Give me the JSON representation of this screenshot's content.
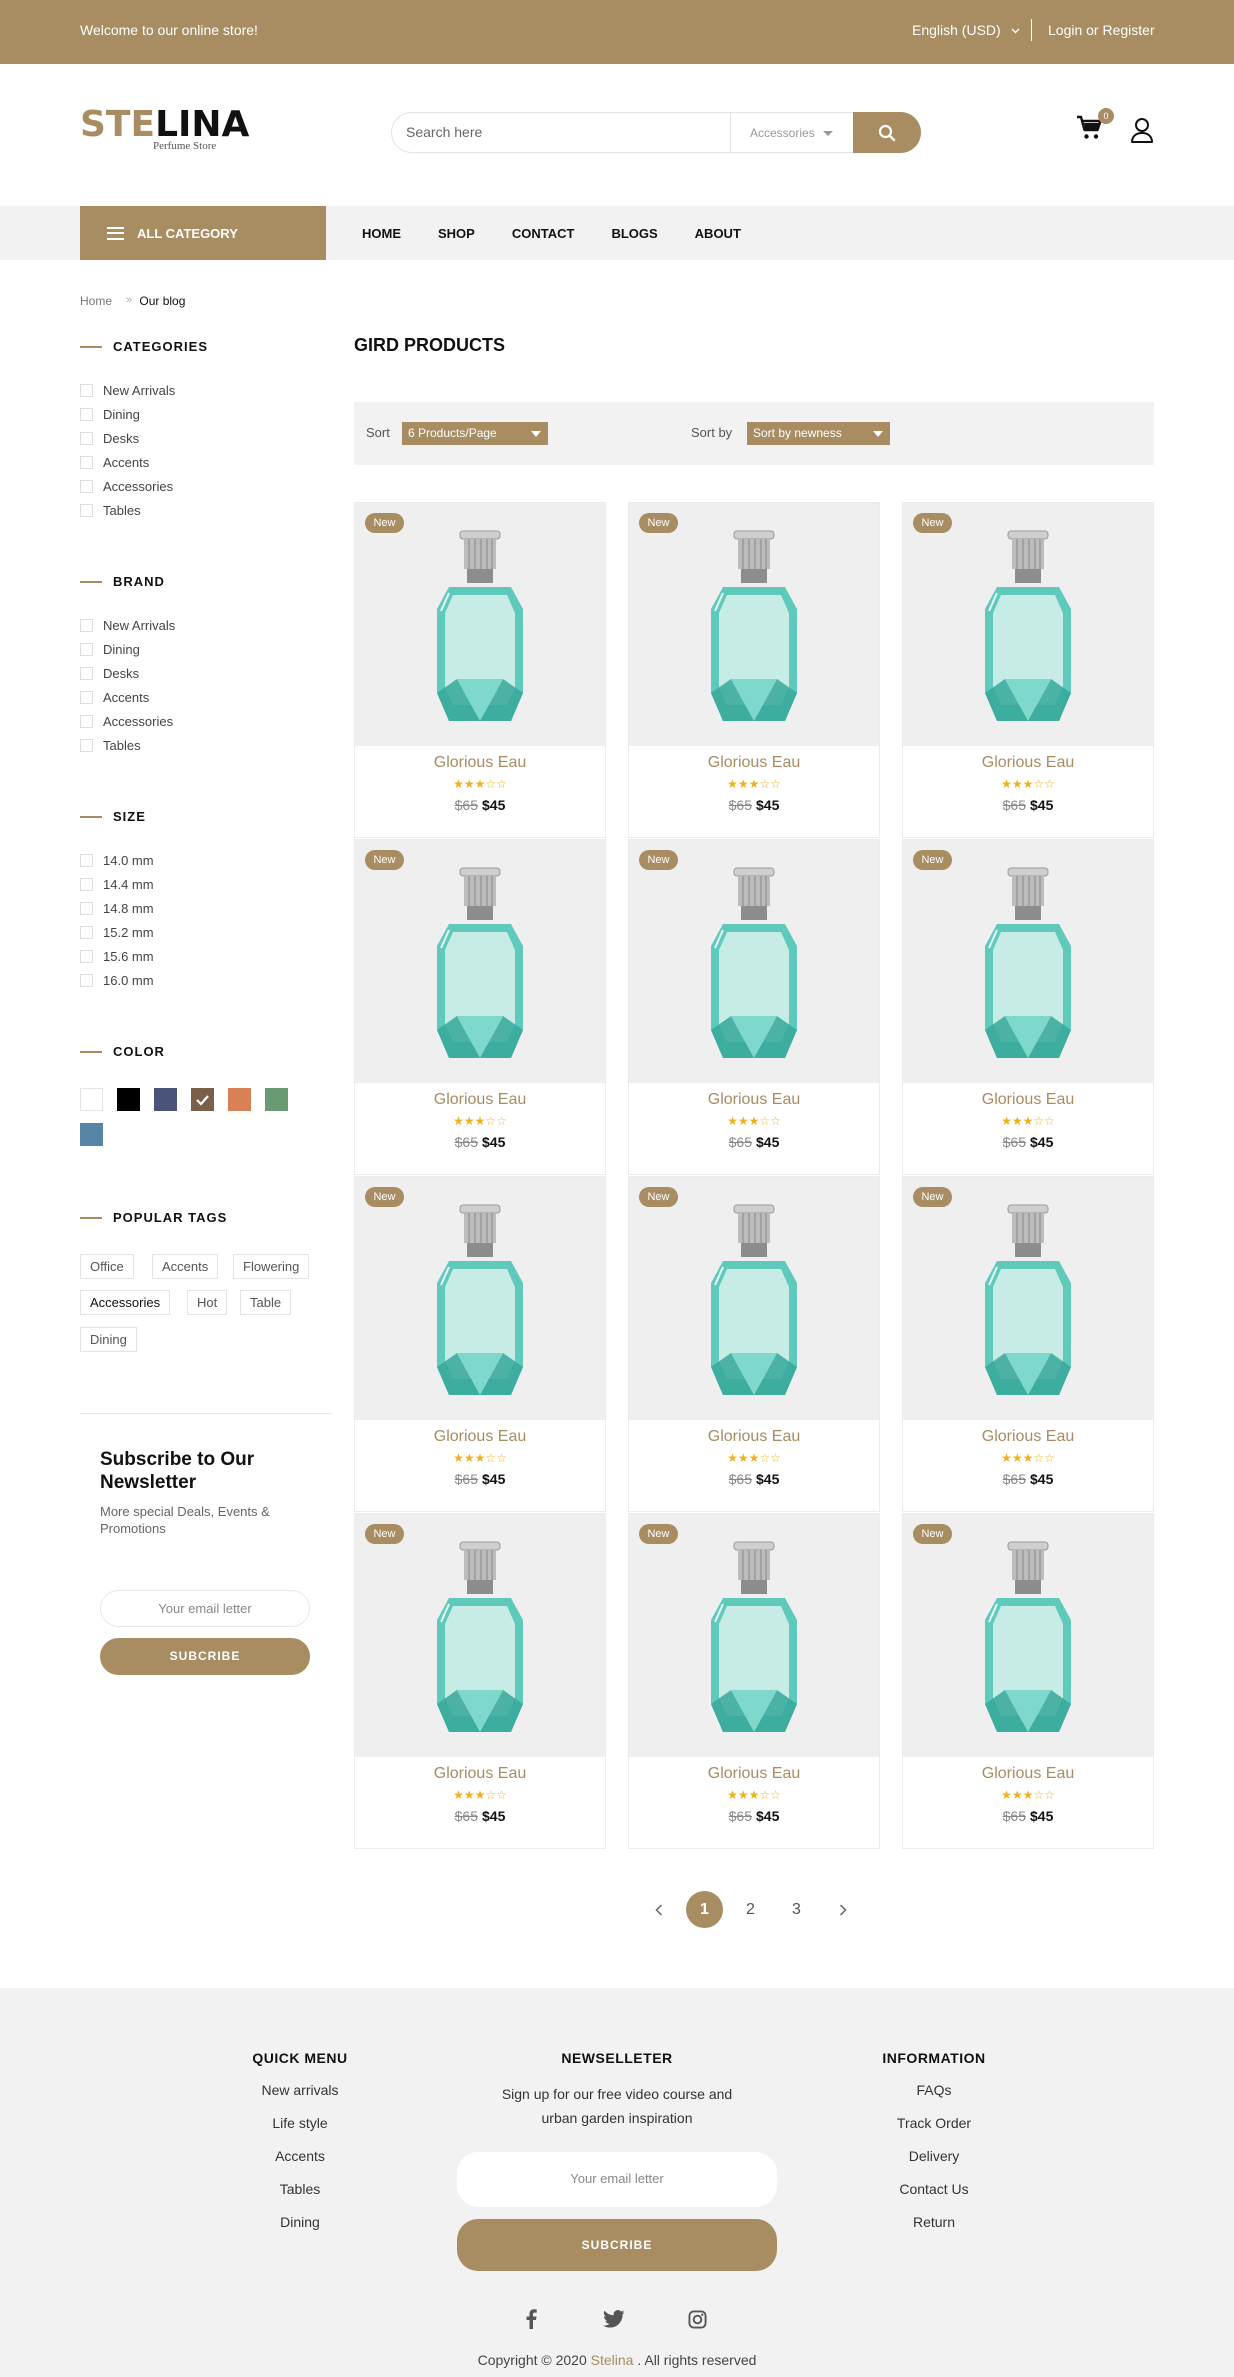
{
  "topbar": {
    "welcome": "Welcome to our online store!",
    "language": "English (USD)",
    "login": "Login or Register"
  },
  "logo": {
    "part1": "STE",
    "part2": "LINA",
    "tagline": "Perfume Store"
  },
  "search": {
    "placeholder": "Search here",
    "category": "Accessories"
  },
  "cart": {
    "count": "0"
  },
  "nav": {
    "all_category": "ALL CATEGORY",
    "items": [
      "HOME",
      "SHOP",
      "CONTACT",
      "BLOGS",
      "ABOUT"
    ]
  },
  "breadcrumb": {
    "home": "Home",
    "current": "Our blog"
  },
  "sidebar": {
    "categories": {
      "title": "CATEGORIES",
      "items": [
        "New Arrivals",
        "Dining",
        "Desks",
        "Accents",
        "Accessories",
        "Tables"
      ]
    },
    "brand": {
      "title": "BRAND",
      "items": [
        "New Arrivals",
        "Dining",
        "Desks",
        "Accents",
        "Accessories",
        "Tables"
      ]
    },
    "size": {
      "title": "SIZE",
      "items": [
        "14.0 mm",
        "14.4 mm",
        "14.8 mm",
        "15.2 mm",
        "15.6 mm",
        "16.0 mm"
      ]
    },
    "color": {
      "title": "COLOR",
      "swatches": [
        "#ffffff",
        "#000000",
        "#4a5478",
        "#7a5f4a",
        "#d98055",
        "#6a9a72",
        "#5885a5"
      ],
      "selected_index": 3
    },
    "tags": {
      "title": "POPULAR TAGS",
      "items": [
        "Office",
        "Accents",
        "Flowering",
        "Accessories",
        "Hot",
        "Table",
        "Dining"
      ]
    },
    "subscribe": {
      "title": "Subscribe to Our Newsletter",
      "text": "More special Deals, Events & Promotions",
      "placeholder": "Your email letter",
      "button": "SUBCRIBE"
    }
  },
  "main": {
    "title": "GIRD PRODUCTS",
    "sort_label": "Sort",
    "sort_value": "6 Products/Page",
    "sortby_label": "Sort by",
    "sortby_value": "Sort by newness",
    "products": [
      {
        "badge": "New",
        "name": "Glorious Eau",
        "rating": 3,
        "old_price": "$65",
        "price": "$45"
      },
      {
        "badge": "New",
        "name": "Glorious Eau",
        "rating": 3,
        "old_price": "$65",
        "price": "$45"
      },
      {
        "badge": "New",
        "name": "Glorious Eau",
        "rating": 3,
        "old_price": "$65",
        "price": "$45"
      },
      {
        "badge": "New",
        "name": "Glorious Eau",
        "rating": 3,
        "old_price": "$65",
        "price": "$45"
      },
      {
        "badge": "New",
        "name": "Glorious Eau",
        "rating": 3,
        "old_price": "$65",
        "price": "$45"
      },
      {
        "badge": "New",
        "name": "Glorious Eau",
        "rating": 3,
        "old_price": "$65",
        "price": "$45"
      },
      {
        "badge": "New",
        "name": "Glorious Eau",
        "rating": 3,
        "old_price": "$65",
        "price": "$45"
      },
      {
        "badge": "New",
        "name": "Glorious Eau",
        "rating": 3,
        "old_price": "$65",
        "price": "$45"
      },
      {
        "badge": "New",
        "name": "Glorious Eau",
        "rating": 3,
        "old_price": "$65",
        "price": "$45"
      },
      {
        "badge": "New",
        "name": "Glorious Eau",
        "rating": 3,
        "old_price": "$65",
        "price": "$45"
      },
      {
        "badge": "New",
        "name": "Glorious Eau",
        "rating": 3,
        "old_price": "$65",
        "price": "$45"
      },
      {
        "badge": "New",
        "name": "Glorious Eau",
        "rating": 3,
        "old_price": "$65",
        "price": "$45"
      }
    ],
    "pagination": {
      "pages": [
        "1",
        "2",
        "3"
      ],
      "current": "1"
    }
  },
  "footer": {
    "quick_menu": {
      "title": "QUICK MENU",
      "items": [
        "New arrivals",
        "Life style",
        "Accents",
        "Tables",
        "Dining"
      ]
    },
    "newsletter": {
      "title": "NEWSELLETER",
      "text": "Sign up for our free video course and urban garden inspiration",
      "placeholder": "Your email letter",
      "button": "SUBCRIBE"
    },
    "information": {
      "title": "INFORMATION",
      "items": [
        "FAQs",
        "Track Order",
        "Delivery",
        "Contact Us",
        "Return"
      ]
    },
    "social": [
      "facebook-icon",
      "twitter-icon",
      "instagram-icon"
    ],
    "copyright_prefix": "Copyright © 2020",
    "copyright_brand": "Stelina",
    "copyright_suffix": ". All rights reserved"
  },
  "colors": {
    "accent": "#a88c62",
    "light_bg": "#f2f2f2",
    "star": "#f2b01e"
  }
}
